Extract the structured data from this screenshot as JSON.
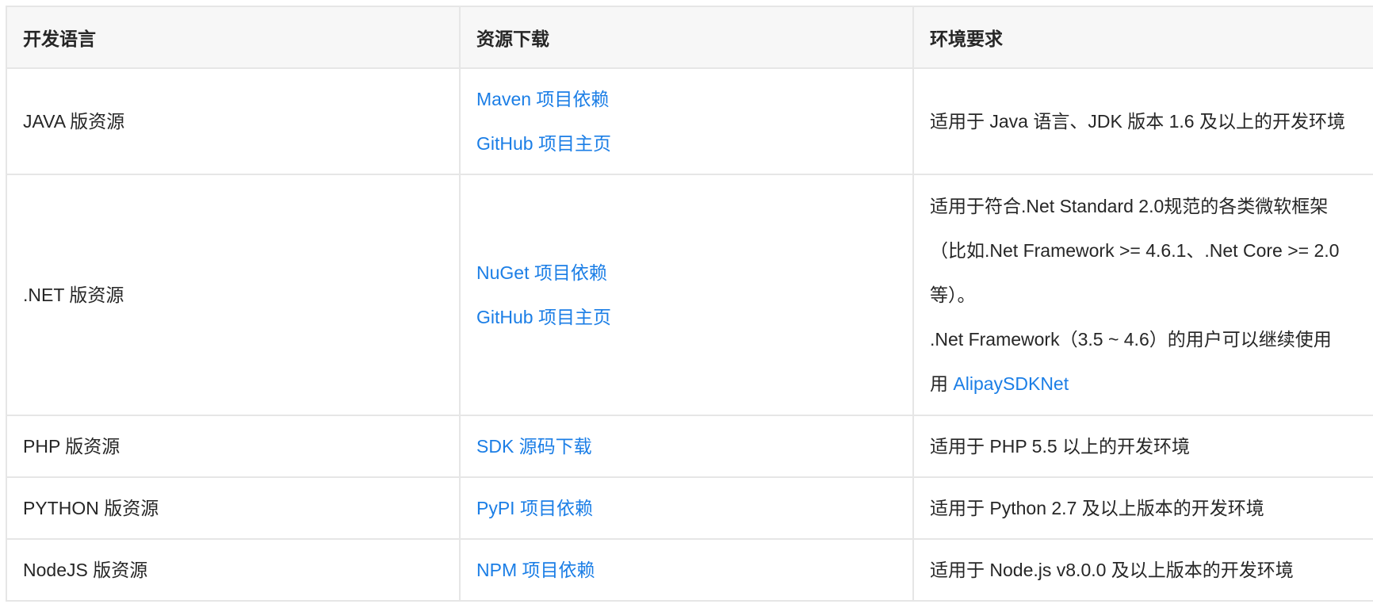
{
  "headers": [
    "开发语言",
    "资源下载",
    "环境要求"
  ],
  "rows": [
    {
      "language": "JAVA 版资源",
      "links": [
        "Maven 项目依赖",
        "GitHub 项目主页"
      ],
      "env": [
        "适用于 Java 语言、JDK 版本 1.6 及以上的开发环境"
      ]
    },
    {
      "language": ".NET 版资源",
      "links": [
        "NuGet 项目依赖",
        "GitHub 项目主页"
      ],
      "env": [
        "适用于符合.Net Standard 2.0规范的各类微软框架（比如.Net Framework >= 4.6.1、.Net Core >= 2.0等）。",
        ".Net Framework（3.5 ~ 4.6）的用户可以继续使用"
      ],
      "env_link": "AlipaySDKNet"
    },
    {
      "language": "PHP 版资源",
      "links": [
        "SDK 源码下载"
      ],
      "env": [
        "适用于 PHP 5.5 以上的开发环境"
      ]
    },
    {
      "language": "PYTHON 版资源",
      "links": [
        "PyPI 项目依赖"
      ],
      "env": [
        "适用于 Python 2.7 及以上版本的开发环境"
      ]
    },
    {
      "language": "NodeJS 版资源",
      "links": [
        "NPM 项目依赖"
      ],
      "env": [
        "适用于 Node.js v8.0.0 及以上版本的开发环境"
      ]
    }
  ],
  "colors": {
    "link": "#1b7ee6",
    "border": "#e6e6e6",
    "header_bg": "#f7f7f7",
    "text": "#262626"
  }
}
